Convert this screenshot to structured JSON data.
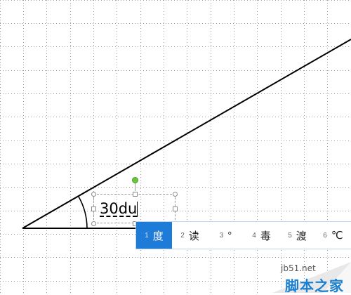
{
  "textbox": {
    "text": "30du"
  },
  "ime": {
    "candidates": [
      {
        "num": "1",
        "text": "度",
        "selected": true
      },
      {
        "num": "2",
        "text": "读",
        "selected": false
      },
      {
        "num": "3",
        "text": "°",
        "selected": false
      },
      {
        "num": "4",
        "text": "毒",
        "selected": false
      },
      {
        "num": "5",
        "text": "渡",
        "selected": false
      },
      {
        "num": "6",
        "text": "℃",
        "selected": false
      }
    ]
  },
  "colors": {
    "selected_candidate": "#1f7bd8",
    "rotate_handle": "#6ac43a",
    "line": "#000000",
    "grid_dots": "#9a9a9a",
    "watermark_text": "#1a7fd0"
  },
  "watermark": {
    "url": "jb51.net",
    "name": "脚本之家"
  }
}
